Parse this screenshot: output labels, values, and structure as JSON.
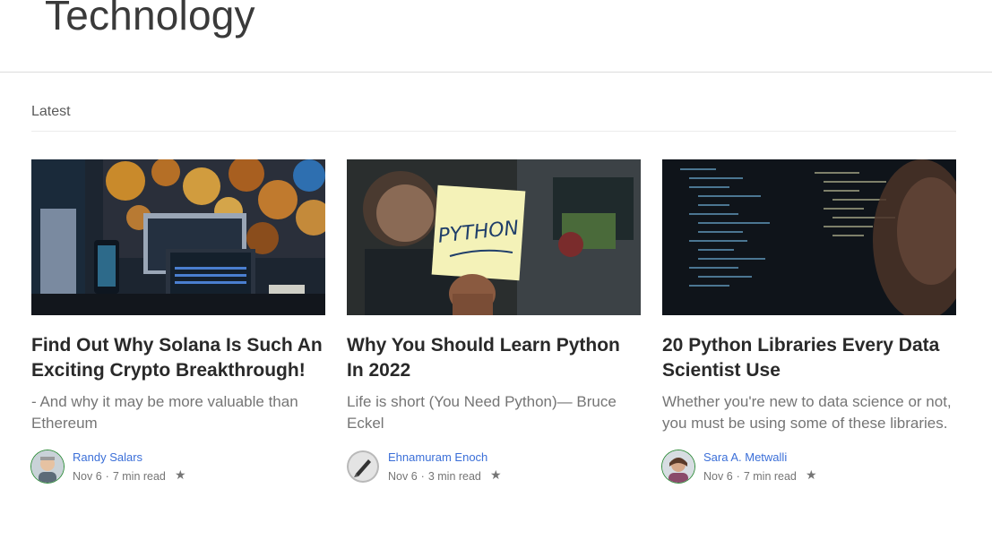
{
  "page": {
    "title": "Technology"
  },
  "section": {
    "label": "Latest"
  },
  "articles": [
    {
      "title": "Find Out Why Solana Is Such An Exciting Crypto Breakthrough!",
      "subtitle": "- And why it may be more valuable than Ethereum",
      "author": "Randy Salars",
      "date": "Nov 6",
      "read_time": "7 min read",
      "bookmark_icon": "star-icon"
    },
    {
      "title": "Why You Should Learn Python In 2022",
      "subtitle": "Life is short (You Need Python)— Bruce Eckel",
      "author": "Ehnamuram Enoch",
      "date": "Nov 6",
      "read_time": "3 min read",
      "bookmark_icon": "star-icon"
    },
    {
      "title": "20 Python Libraries Every Data Scientist Use",
      "subtitle": "Whether you're new to data science or not, you must be using some of these libraries.",
      "author": "Sara A. Metwalli",
      "date": "Nov 6",
      "read_time": "7 min read",
      "bookmark_icon": "star-icon"
    }
  ],
  "thumbnail_text": {
    "python_note": "PYTHON"
  },
  "colors": {
    "author_link": "#3b6fd8",
    "avatar_ring": "#2e8b3a",
    "meta": "#757575"
  }
}
